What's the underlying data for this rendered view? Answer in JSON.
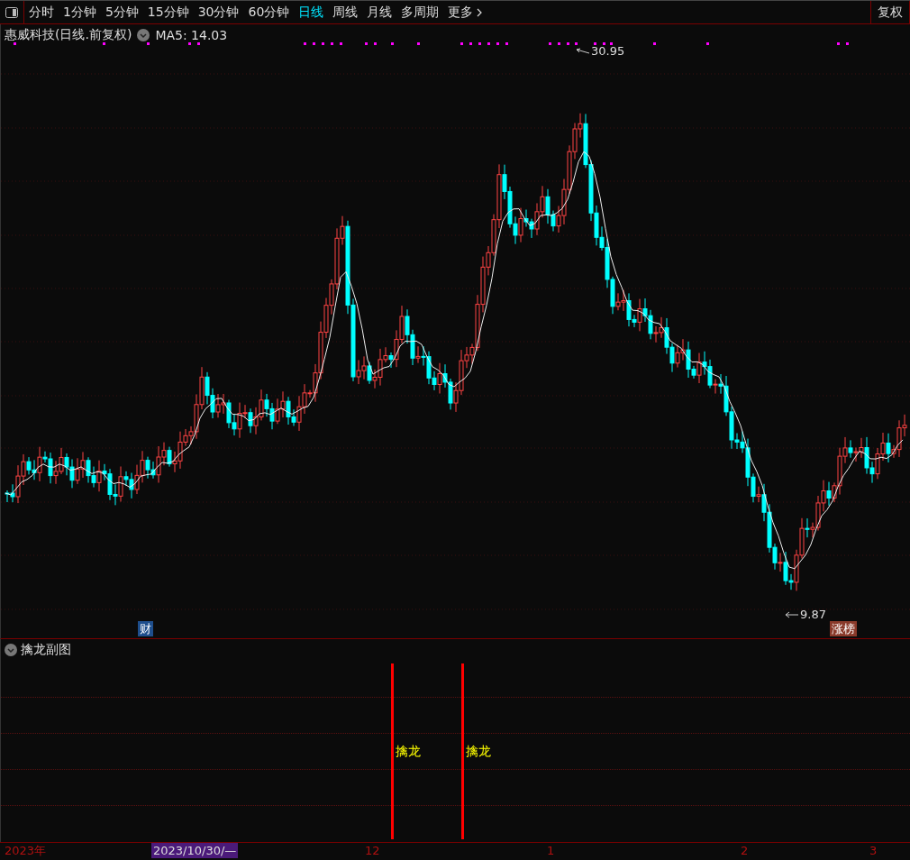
{
  "toolbar": {
    "periods": [
      {
        "label": "分时",
        "selected": false
      },
      {
        "label": "1分钟",
        "selected": false
      },
      {
        "label": "5分钟",
        "selected": false
      },
      {
        "label": "15分钟",
        "selected": false
      },
      {
        "label": "30分钟",
        "selected": false
      },
      {
        "label": "60分钟",
        "selected": false
      },
      {
        "label": "日线",
        "selected": true
      },
      {
        "label": "周线",
        "selected": false
      },
      {
        "label": "月线",
        "selected": false
      },
      {
        "label": "多周期",
        "selected": false
      }
    ],
    "more": "更多",
    "adjust": "复权"
  },
  "main_chart": {
    "title": "惠威科技(日线.前复权)",
    "indicator": "MA5: 14.03",
    "high_label": "30.95",
    "low_label": "9.87",
    "markers": [
      {
        "label": "财",
        "color": "#1e4e8c"
      },
      {
        "label": "涨榜",
        "color": "#8a3a2a"
      }
    ]
  },
  "sub_chart": {
    "title": "擒龙副图",
    "signals": [
      {
        "label": "擒龙"
      },
      {
        "label": "擒龙"
      }
    ]
  },
  "date_axis": {
    "cursor_date": "2023/10/30/—",
    "labels": [
      "2023年",
      "12",
      "1",
      "2",
      "3"
    ]
  }
}
